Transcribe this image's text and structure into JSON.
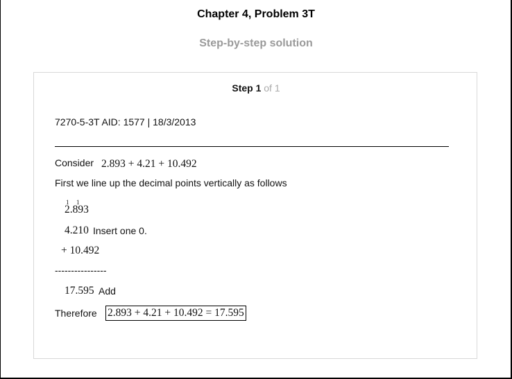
{
  "header": {
    "title": "Chapter 4, Problem 3T",
    "subtitle": "Step-by-step solution"
  },
  "step": {
    "label": "Step 1",
    "of": "of 1"
  },
  "solution": {
    "meta": "7270-5-3T AID: 1577 | 18/3/2013",
    "consider_label": "Consider",
    "expression": "2.893 + 4.21 + 10.492",
    "intro": "First we line up the decimal points vertically as follows",
    "carries": [
      "1",
      "1"
    ],
    "row1": "2.893",
    "row2": "4.210",
    "row2_note": "Insert one 0.",
    "row3": "+ 10.492",
    "dashes": "----------------",
    "sum": "17.595",
    "sum_note": "Add",
    "therefore_label": "Therefore",
    "result": "2.893 + 4.21 + 10.492 = 17.595"
  }
}
